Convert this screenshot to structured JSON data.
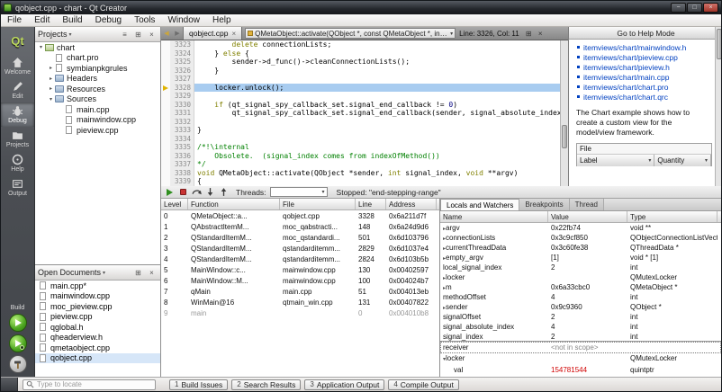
{
  "colors": {
    "keyword": "#808000",
    "comment": "#008000",
    "number": "#000080",
    "link": "#0040c0",
    "debug-line": "#a8ccf0",
    "exec-arrow": "#e0b400",
    "changed-value": "#d00000"
  },
  "titlebar": {
    "title": "qobject.cpp - chart - Qt Creator"
  },
  "menubar": {
    "items": [
      "File",
      "Edit",
      "Build",
      "Debug",
      "Tools",
      "Window",
      "Help"
    ]
  },
  "modebar": {
    "logo": "Qt",
    "build_label": "Build",
    "items": [
      {
        "label": "Welcome",
        "icon": "welcome",
        "active": false
      },
      {
        "label": "Edit",
        "icon": "edit",
        "active": false
      },
      {
        "label": "Debug",
        "icon": "debug",
        "active": true
      },
      {
        "label": "Projects",
        "icon": "projects",
        "active": false
      },
      {
        "label": "Help",
        "icon": "help",
        "active": false
      },
      {
        "label": "Output",
        "icon": "output",
        "active": false
      }
    ]
  },
  "projects_panel": {
    "title": "Projects",
    "tree": [
      {
        "label": "chart",
        "depth": 0,
        "arrow": "down",
        "icon": "app"
      },
      {
        "label": "chart.pro",
        "depth": 1,
        "arrow": "none",
        "icon": "file"
      },
      {
        "label": "symbianpkgrules",
        "depth": 1,
        "arrow": "right",
        "icon": "file"
      },
      {
        "label": "Headers",
        "depth": 1,
        "arrow": "right",
        "icon": "folder"
      },
      {
        "label": "Resources",
        "depth": 1,
        "arrow": "right",
        "icon": "folder"
      },
      {
        "label": "Sources",
        "depth": 1,
        "arrow": "down",
        "icon": "folder"
      },
      {
        "label": "main.cpp",
        "depth": 2,
        "arrow": "none",
        "icon": "file"
      },
      {
        "label": "mainwindow.cpp",
        "depth": 2,
        "arrow": "none",
        "icon": "file"
      },
      {
        "label": "pieview.cpp",
        "depth": 2,
        "arrow": "none",
        "icon": "file"
      }
    ]
  },
  "open_documents": {
    "title": "Open Documents",
    "files": [
      {
        "name": "main.cpp*"
      },
      {
        "name": "mainwindow.cpp"
      },
      {
        "name": "moc_pieview.cpp"
      },
      {
        "name": "pieview.cpp"
      },
      {
        "name": "qglobal.h"
      },
      {
        "name": "qheaderview.h"
      },
      {
        "name": "qmetaobject.cpp"
      },
      {
        "name": "qobject.cpp",
        "current": true
      }
    ]
  },
  "editor": {
    "tab": "qobject.cpp",
    "symbol": "QMetaObject::activate(QObject *, const QMetaObject *, int, void**)",
    "line_col": "Line: 3326, Col: 11",
    "current_line": 3328,
    "lines": [
      {
        "n": 3323,
        "seg": [
          [
            "        ",
            ""
          ],
          [
            "delete",
            "kw"
          ],
          [
            " connectionLists;",
            ""
          ]
        ]
      },
      {
        "n": 3324,
        "seg": [
          [
            "    } ",
            ""
          ],
          [
            "else",
            "kw"
          ],
          [
            " {",
            ""
          ]
        ]
      },
      {
        "n": 3325,
        "seg": [
          [
            "        sender->d_func()->cleanConnectionLists();",
            ""
          ]
        ]
      },
      {
        "n": 3326,
        "seg": [
          [
            "    }",
            ""
          ]
        ]
      },
      {
        "n": 3327,
        "seg": []
      },
      {
        "n": 3328,
        "seg": [
          [
            "    locker.unlock();",
            ""
          ]
        ]
      },
      {
        "n": 3329,
        "seg": []
      },
      {
        "n": 3330,
        "seg": [
          [
            "    ",
            ""
          ],
          [
            "if",
            "kw"
          ],
          [
            " (qt_signal_spy_callback_set.signal_end_callback != ",
            ""
          ],
          [
            "0",
            "num"
          ],
          [
            ")",
            ""
          ]
        ]
      },
      {
        "n": 3331,
        "seg": [
          [
            "        qt_signal_spy_callback_set.signal_end_callback(sender, signal_absolute_index);",
            ""
          ]
        ]
      },
      {
        "n": 3332,
        "seg": []
      },
      {
        "n": 3333,
        "seg": [
          [
            "}",
            ""
          ]
        ]
      },
      {
        "n": 3334,
        "seg": []
      },
      {
        "n": 3335,
        "seg": [
          [
            "/*!\\internal",
            "cm"
          ]
        ]
      },
      {
        "n": 3336,
        "seg": [
          [
            "    Obsolete.  (signal_index comes from indexOfMethod())",
            "cm"
          ]
        ]
      },
      {
        "n": 3337,
        "seg": [
          [
            "*/",
            "cm"
          ]
        ]
      },
      {
        "n": 3338,
        "seg": [
          [
            "void",
            "kw"
          ],
          [
            " QMetaObject::activate(QObject *sender, ",
            ""
          ],
          [
            "int",
            "kw"
          ],
          [
            " signal_index, ",
            ""
          ],
          [
            "void",
            "kw"
          ],
          [
            " **argv)",
            ""
          ]
        ]
      },
      {
        "n": 3339,
        "seg": [
          [
            "{",
            ""
          ]
        ]
      }
    ]
  },
  "help_panel": {
    "button": "Go to Help Mode",
    "links": [
      "itemviews/chart/mainwindow.h",
      "itemviews/chart/pieview.cpp",
      "itemviews/chart/pieview.h",
      "itemviews/chart/main.cpp",
      "itemviews/chart/chart.pro",
      "itemviews/chart/chart.qrc"
    ],
    "description": "The Chart example shows how to create a custom view for the model/view framework.",
    "example_menu": "File",
    "example_headers": [
      "Label",
      "Quantity"
    ]
  },
  "debugger": {
    "threads_label": "Threads:",
    "status": "Stopped: \"end-stepping-range\"",
    "stack": {
      "headers": [
        "Level",
        "Function",
        "File",
        "Line",
        "Address"
      ],
      "rows": [
        {
          "cells": [
            "0",
            "QMetaObject::a...",
            "qobject.cpp",
            "3328",
            "0x6a211d7f"
          ]
        },
        {
          "cells": [
            "1",
            "QAbstractItemM...",
            "moc_qabstracti...",
            "148",
            "0x6a24d9d6"
          ]
        },
        {
          "cells": [
            "2",
            "QStandardItemM...",
            "moc_qstandardi...",
            "501",
            "0x6d103796"
          ]
        },
        {
          "cells": [
            "3",
            "QStandardItemM...",
            "qstandarditemm...",
            "2829",
            "0x6d1037e4"
          ]
        },
        {
          "cells": [
            "4",
            "QStandardItemM...",
            "qstandarditemm...",
            "2824",
            "0x6d103b5b"
          ]
        },
        {
          "cells": [
            "5",
            "MainWindow::c...",
            "mainwindow.cpp",
            "130",
            "0x00402597"
          ]
        },
        {
          "cells": [
            "6",
            "MainWindow::M...",
            "mainwindow.cpp",
            "100",
            "0x004024b7"
          ]
        },
        {
          "cells": [
            "7",
            "qMain",
            "main.cpp",
            "51",
            "0x004013eb"
          ]
        },
        {
          "cells": [
            "8",
            "WinMain@16",
            "qtmain_win.cpp",
            "131",
            "0x00407822"
          ]
        },
        {
          "cells": [
            "9",
            "main",
            "",
            "0",
            "0x004010b8"
          ],
          "dim": true
        }
      ]
    },
    "tabs": [
      "Locals and Watchers",
      "Breakpoints",
      "Thread"
    ],
    "locals": {
      "headers": [
        "Name",
        "Value",
        "Type"
      ],
      "rows": [
        {
          "expand": "right",
          "name": "argv",
          "value": "0x22fb74",
          "type": "void **"
        },
        {
          "expand": "right",
          "name": "connectionLists",
          "value": "0x3c9cf850",
          "type": "QObjectConnectionListVector *"
        },
        {
          "expand": "right",
          "name": "currentThreadData",
          "value": "0x3c60fe38",
          "type": "QThreadData *"
        },
        {
          "expand": "right",
          "name": "empty_argv",
          "value": "[1]",
          "type": "void * [1]"
        },
        {
          "name": "local_signal_index",
          "value": "2",
          "type": "int"
        },
        {
          "expand": "right",
          "name": "locker",
          "value": "",
          "type": "QMutexLocker"
        },
        {
          "expand": "right",
          "name": "m",
          "value": "0x6a33cbc0",
          "type": "QMetaObject *"
        },
        {
          "name": "methodOffset",
          "value": "4",
          "type": "int"
        },
        {
          "expand": "right",
          "name": "sender",
          "value": "0x9c9360",
          "type": "QObject *"
        },
        {
          "name": "signalOffset",
          "value": "2",
          "type": "int"
        },
        {
          "name": "signal_absolute_index",
          "value": "4",
          "type": "int"
        },
        {
          "name": "signal_index",
          "value": "2",
          "type": "int"
        }
      ]
    },
    "watch": {
      "rows": [
        {
          "name": "receiver",
          "value": "<not in scope>",
          "dim": true,
          "focus": true
        },
        {
          "expand": "down",
          "name": "locker",
          "value": "",
          "type": "QMutexLocker"
        },
        {
          "name": "val",
          "value": "154781544",
          "type": "quintptr",
          "red": true,
          "indent": 1
        }
      ]
    }
  },
  "statusbar": {
    "locate_placeholder": "Type to locate",
    "buttons": [
      {
        "num": "1",
        "label": "Build Issues"
      },
      {
        "num": "2",
        "label": "Search Results"
      },
      {
        "num": "3",
        "label": "Application Output"
      },
      {
        "num": "4",
        "label": "Compile Output"
      }
    ]
  }
}
